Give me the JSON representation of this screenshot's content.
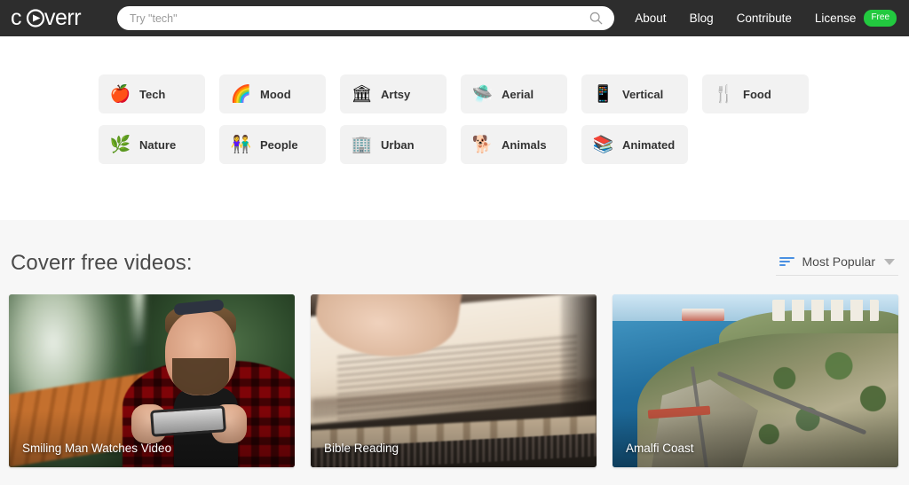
{
  "header": {
    "logo_text": "coverr",
    "logo_icon": "play-circle-icon",
    "search": {
      "placeholder": "Try \"tech\"",
      "value": "",
      "icon": "search-icon"
    },
    "nav": [
      {
        "label": "About"
      },
      {
        "label": "Blog"
      },
      {
        "label": "Contribute"
      },
      {
        "label": "License",
        "badge": "Free"
      }
    ],
    "badge_color": "#22c93f",
    "background_color": "#2d2d2d"
  },
  "categories": {
    "row1": [
      {
        "label": "Tech",
        "emoji": "🍎",
        "icon": "apple-icon"
      },
      {
        "label": "Mood",
        "emoji": "🌈",
        "icon": "rainbow-icon"
      },
      {
        "label": "Artsy",
        "emoji": "🏛",
        "icon": "classical-building-icon"
      },
      {
        "label": "Aerial",
        "emoji": "🛸",
        "icon": "drone-icon"
      },
      {
        "label": "Vertical",
        "emoji": "📱",
        "icon": "mobile-phone-icon"
      },
      {
        "label": "Food",
        "emoji": "🍴",
        "icon": "fork-and-knife-icon"
      }
    ],
    "row2": [
      {
        "label": "Nature",
        "emoji": "🌿",
        "icon": "herb-icon"
      },
      {
        "label": "People",
        "emoji": "👫",
        "icon": "couple-icon"
      },
      {
        "label": "Urban",
        "emoji": "🏢",
        "icon": "cityscape-icon"
      },
      {
        "label": "Animals",
        "emoji": "🐕",
        "icon": "dog-icon"
      },
      {
        "label": "Animated",
        "emoji": "📚",
        "icon": "layers-icon"
      }
    ]
  },
  "main": {
    "section_title": "Coverr free videos:",
    "sort": {
      "label": "Most Popular",
      "icon": "sort-lines-icon",
      "caret": "chevron-down-icon",
      "icon_color": "#4a90e2"
    },
    "videos": [
      {
        "title": "Smiling Man Watches Video"
      },
      {
        "title": "Bible Reading"
      },
      {
        "title": "Amalfi Coast"
      }
    ]
  }
}
